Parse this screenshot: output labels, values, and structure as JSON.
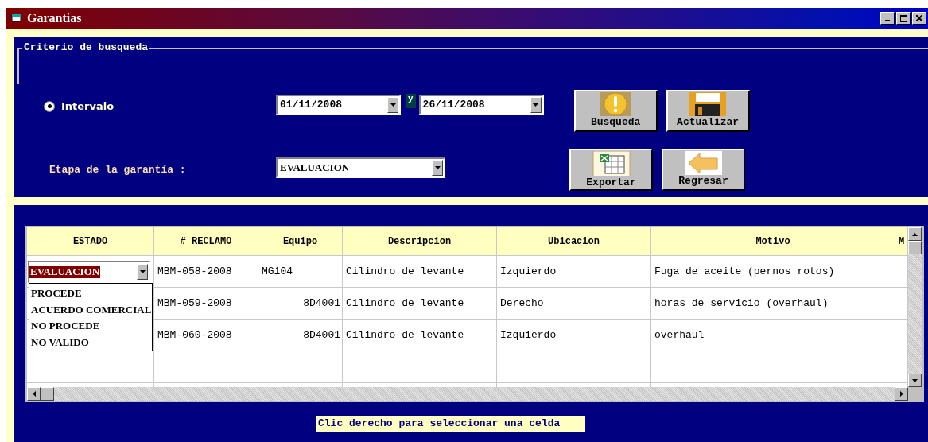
{
  "window": {
    "title": "Garantias"
  },
  "search": {
    "legend": "Criterio de busqueda",
    "radio": {
      "label": "Intervalo",
      "selected": true
    },
    "date_from": "01/11/2008",
    "separator": "y",
    "date_to": "26/11/2008",
    "stage_label": "Etapa de la garantía :",
    "stage_value": "EVALUACION",
    "buttons": [
      {
        "kind": "search",
        "label": "Busqueda"
      },
      {
        "kind": "save",
        "label": "Actualizar"
      },
      {
        "kind": "export",
        "label": "Exportar"
      },
      {
        "kind": "back",
        "label": "Regresar"
      }
    ]
  },
  "table": {
    "columns": [
      "ESTADO",
      "# RECLAMO",
      "Equipo",
      "Descripcion",
      "Ubicacion",
      "Motivo",
      "M"
    ],
    "estado_editor": {
      "value": "EVALUACION",
      "options": [
        "PROCEDE",
        "ACUERDO COMERCIAL",
        "NO PROCEDE",
        "NO VALIDO"
      ]
    },
    "rows": [
      {
        "reclamo": "MBM-058-2008",
        "equipo": "MG104",
        "equipo_right_aligned": false,
        "descripcion": "Cilindro de levante",
        "ubicacion": "Izquierdo",
        "motivo": "Fuga de aceite (pernos rotos)"
      },
      {
        "reclamo": "MBM-059-2008",
        "equipo": "8D4001",
        "equipo_right_aligned": true,
        "descripcion": "Cilindro de levante",
        "ubicacion": "Derecho",
        "motivo": "horas de servicio (overhaul)"
      },
      {
        "reclamo": "MBM-060-2008",
        "equipo": "8D4001",
        "equipo_right_aligned": true,
        "descripcion": "Cilindro de levante",
        "ubicacion": "Izquierdo",
        "motivo": "overhaul"
      }
    ]
  },
  "status_bar": "Clic derecho para seleccionar una celda"
}
